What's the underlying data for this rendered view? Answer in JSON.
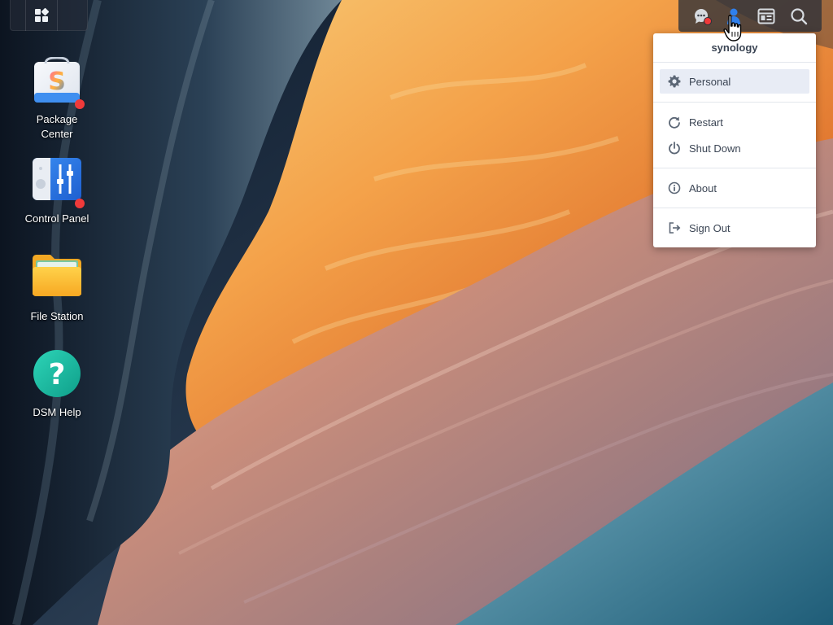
{
  "desktop": {
    "icons": [
      {
        "label": "Package\nCenter",
        "name": "package-center",
        "badge": true
      },
      {
        "label": "Control Panel",
        "name": "control-panel",
        "badge": true
      },
      {
        "label": "File Station",
        "name": "file-station",
        "badge": false
      },
      {
        "label": "DSM Help",
        "name": "dsm-help",
        "badge": false
      }
    ]
  },
  "taskbar": {
    "main_menu_icon": "grid-icon",
    "tray_icons": [
      "chat-icon",
      "user-icon",
      "widgets-icon",
      "search-icon"
    ]
  },
  "user_menu": {
    "title": "synology",
    "items": [
      {
        "label": "Personal",
        "icon": "gear-icon"
      },
      {
        "label": "Restart",
        "icon": "restart-icon"
      },
      {
        "label": "Shut Down",
        "icon": "power-icon"
      },
      {
        "label": "About",
        "icon": "info-icon"
      },
      {
        "label": "Sign Out",
        "icon": "sign-out-icon"
      }
    ]
  },
  "colors": {
    "accent_blue": "#2f80ed",
    "badge_red": "#f03a3a",
    "menu_text": "#3b4554",
    "menu_active_bg": "#e8ecf5"
  }
}
